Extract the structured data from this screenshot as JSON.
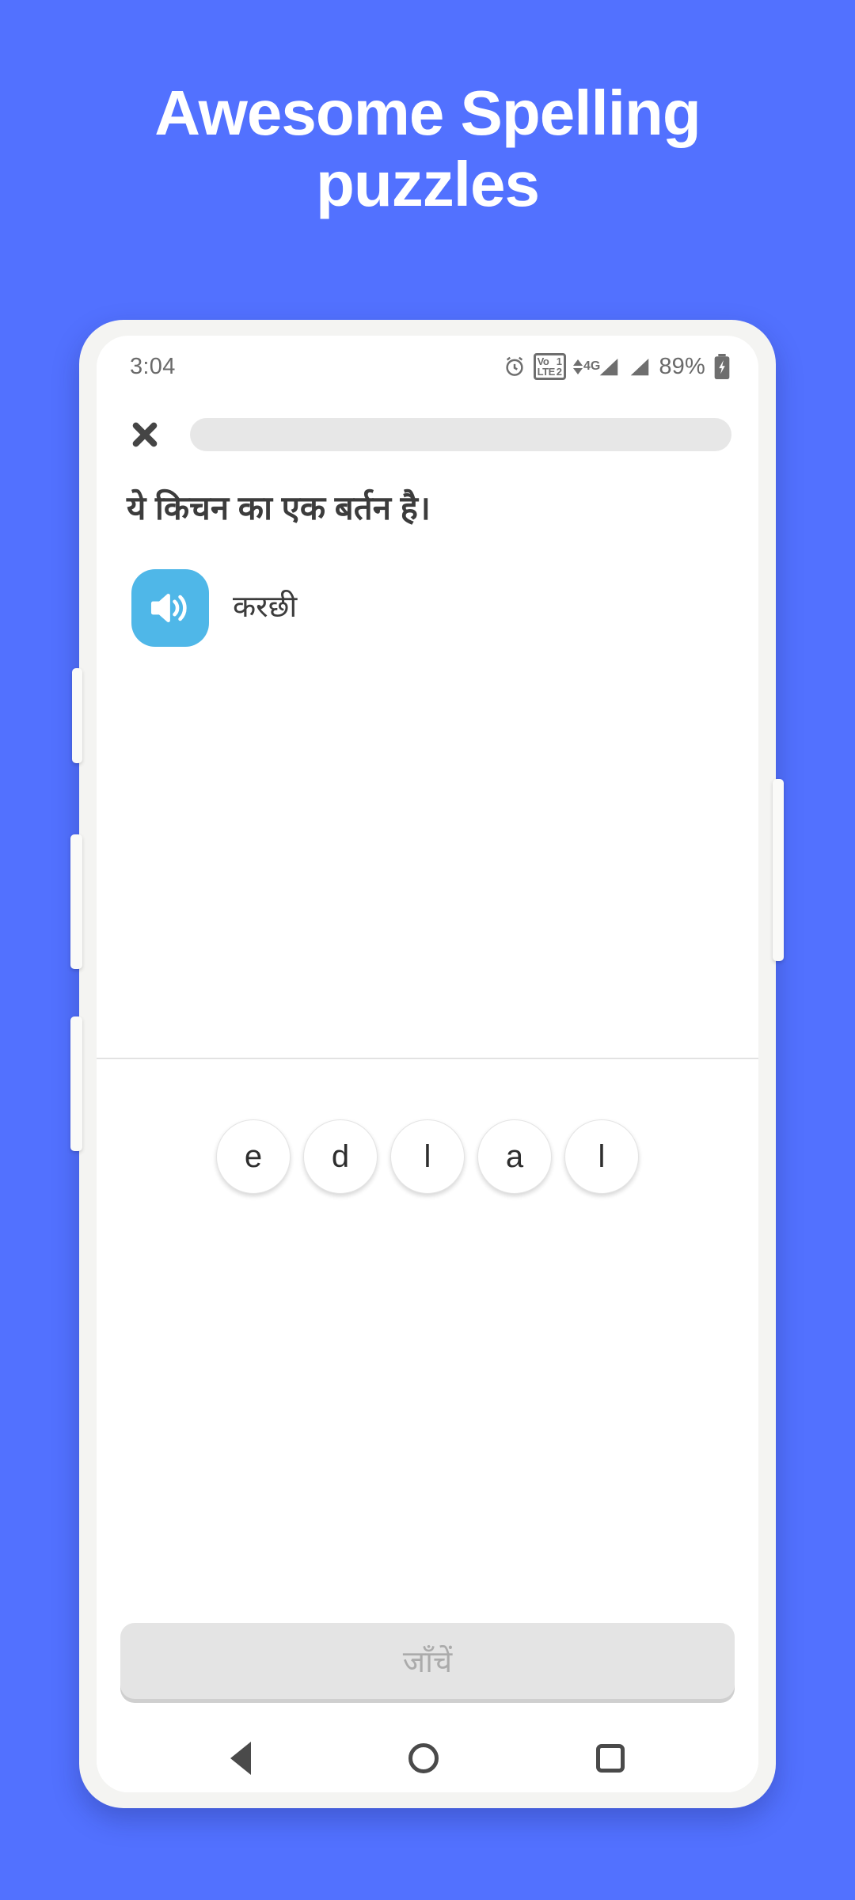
{
  "theme": {
    "background": "#5271FF",
    "headline_color": "#FFFFFF",
    "audio_button_color": "#4FB7E8",
    "progress_track_color": "#E7E7E7",
    "check_button_color": "#E4E4E4",
    "check_button_text_color": "#ABABAB"
  },
  "headline": {
    "line1": "Awesome Spelling",
    "line2": "puzzles"
  },
  "phone": {
    "status_bar": {
      "time": "3:04",
      "battery_percent": "89%",
      "icons": [
        "alarm-icon",
        "volte-icon",
        "signal-4g-icon",
        "signal-icon",
        "battery-charging-icon"
      ],
      "volte": {
        "top_left": "Vo",
        "bottom_left": "LTE",
        "top_right": "1",
        "bottom_right": "2"
      },
      "network_type": "4G"
    },
    "top_bar": {
      "close_label": "✕",
      "progress_percent": 0
    },
    "lesson": {
      "question": "ये किचन का एक बर्तन है।",
      "audio_word": "करछी",
      "letter_tiles": [
        "e",
        "d",
        "l",
        "a",
        "l"
      ],
      "check_label": "जाँचें"
    },
    "nav_bar": {
      "back_label": "back-button",
      "home_label": "home-button",
      "recents_label": "recents-button"
    }
  }
}
